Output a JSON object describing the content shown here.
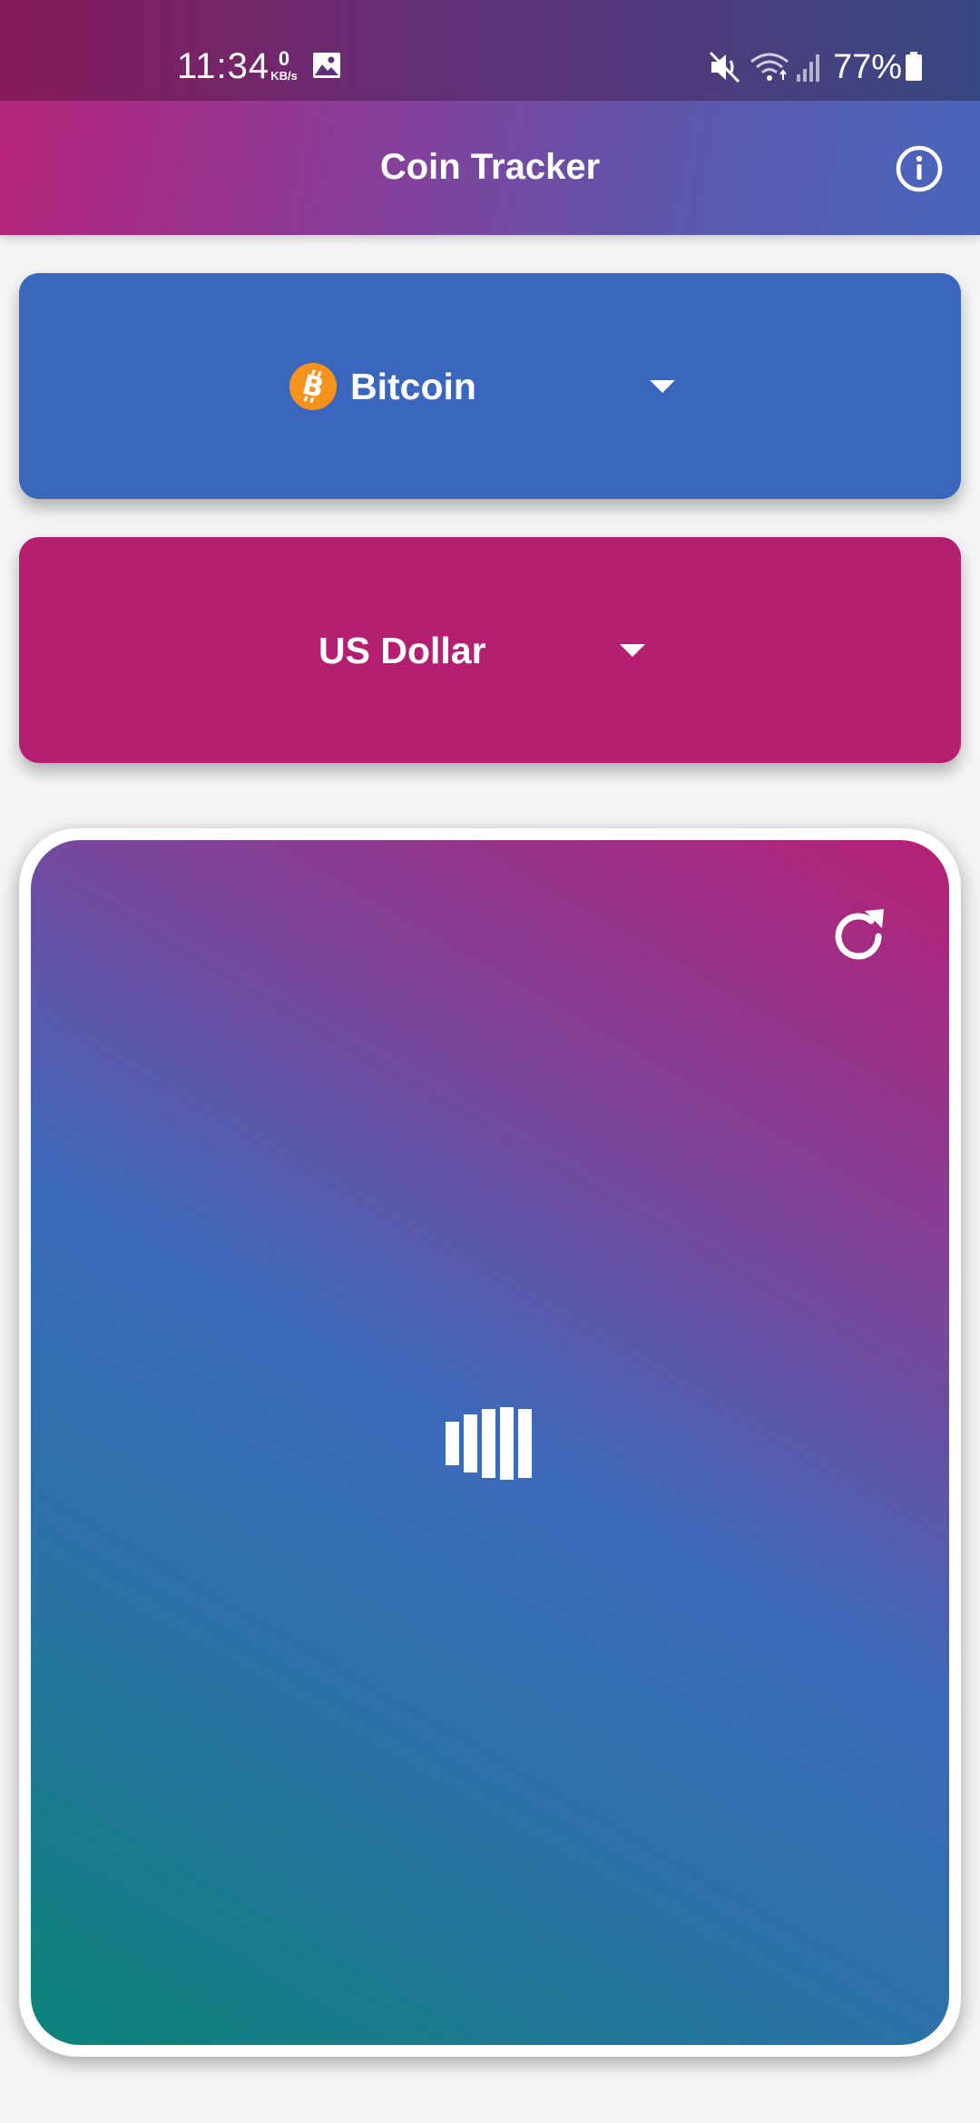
{
  "status_bar": {
    "time": "11:34",
    "net_speed_value": "0",
    "net_speed_unit": "KB/s",
    "battery_percent": "77%",
    "icons": [
      "gallery-icon",
      "mute-icon",
      "wifi-icon",
      "signal-icon",
      "battery-icon"
    ]
  },
  "app_bar": {
    "title": "Coin Tracker",
    "info_icon": "info-icon"
  },
  "coin_selector": {
    "selected": "Bitcoin",
    "icon": "bitcoin-icon",
    "icon_color": "#f7931a",
    "background_color": "#3a66be"
  },
  "currency_selector": {
    "selected": "US Dollar",
    "background_color": "#b41f72"
  },
  "price_panel": {
    "refresh_icon": "refresh-icon",
    "loading_icon": "loading-bars-icon",
    "gradient_colors": [
      "#b81f76",
      "#3c6abb",
      "#0c8478"
    ]
  }
}
